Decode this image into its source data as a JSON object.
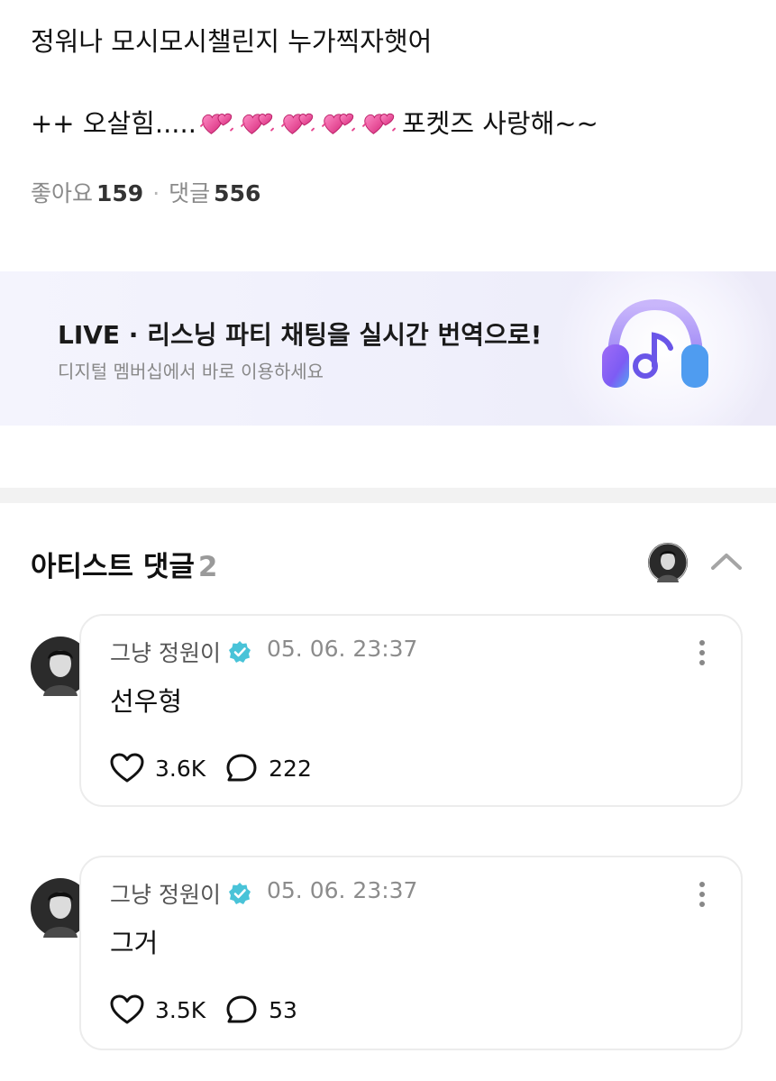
{
  "post": {
    "line1": "정워나 모시모시챌린지 누가찍자햇어",
    "line2_prefix": "++ 오살힘.....",
    "line2_suffix": "포켓즈 사랑해~~",
    "hearts_icon": "revolving-hearts-icon",
    "likes_label": "좋아요",
    "likes_count": "159",
    "comments_label": "댓글",
    "comments_count": "556"
  },
  "banner": {
    "title": "LIVE · 리스닝 파티 채팅을 실시간 번역으로!",
    "subtitle": "디지털 멤버십에서 바로 이용하세요",
    "icon": "headphones-music-icon"
  },
  "artist_comments": {
    "title": "아티스트 댓글",
    "count": "2",
    "items": [
      {
        "author": "그냥 정원이",
        "time": "05. 06. 23:37",
        "text": "선우형",
        "likes": "3.6K",
        "replies": "222"
      },
      {
        "author": "그냥 정원이",
        "time": "05. 06. 23:37",
        "text": "그거",
        "likes": "3.5K",
        "replies": "53"
      }
    ]
  },
  "colors": {
    "verified": "#49c3d8",
    "heart_pink": "#e6458f",
    "headphone_purple": "#7d5cf4",
    "headphone_blue": "#52a7f2"
  }
}
